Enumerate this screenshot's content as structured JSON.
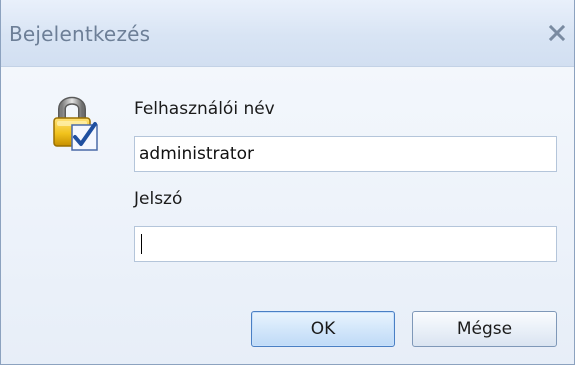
{
  "window": {
    "title": "Bejelentkezés",
    "close_symbol": "x"
  },
  "icons": {
    "lock": "lock-with-checkmark-icon",
    "close": "close-icon"
  },
  "form": {
    "username_label": "Felhasználói név",
    "username_value": "administrator",
    "password_label": "Jelszó",
    "password_value": ""
  },
  "buttons": {
    "ok_label": "OK",
    "cancel_label": "Mégse"
  },
  "colors": {
    "title_text": "#6d7f97",
    "default_button_border": "#4a7fc4",
    "lock_body": "#e8b800",
    "checkmark": "#1f4fa0"
  }
}
